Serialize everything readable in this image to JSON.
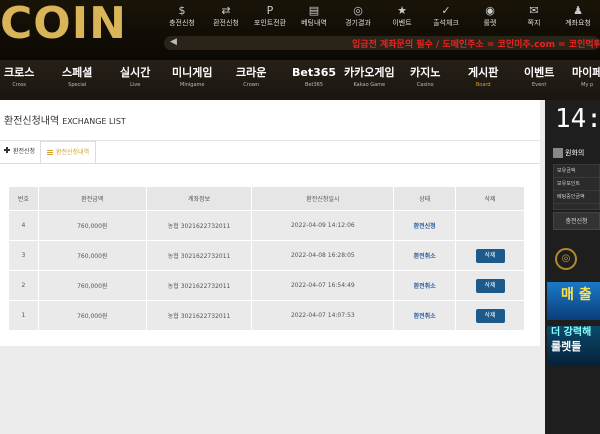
{
  "logo": {
    "text": "COIN"
  },
  "top_menu": [
    {
      "icon": "money-icon",
      "glyph": "$",
      "label": "충전신청"
    },
    {
      "icon": "exchange-icon",
      "glyph": "⇄",
      "label": "환전신청"
    },
    {
      "icon": "points-icon",
      "glyph": "P",
      "label": "포인트전환"
    },
    {
      "icon": "bet-icon",
      "glyph": "▤",
      "label": "베팅내역"
    },
    {
      "icon": "result-icon",
      "glyph": "◎",
      "label": "경기결과"
    },
    {
      "icon": "event-icon",
      "glyph": "★",
      "label": "이벤트"
    },
    {
      "icon": "attendance-icon",
      "glyph": "✓",
      "label": "출석체크"
    },
    {
      "icon": "roulette-icon",
      "glyph": "◉",
      "label": "룰렛"
    },
    {
      "icon": "message-icon",
      "glyph": "✉",
      "label": "쪽지"
    },
    {
      "icon": "account-icon",
      "glyph": "♟",
      "label": "계좌요청"
    }
  ],
  "ticker": {
    "speaker_glyph": "◀",
    "message": "입금전 계좌문의 필수 / 도메인주소 = 코인미추.com = 코인먹튀"
  },
  "nav": [
    {
      "ko": "크로스",
      "en": "Cross"
    },
    {
      "ko": "스페셜",
      "en": "Special"
    },
    {
      "ko": "실시간",
      "en": "Live"
    },
    {
      "ko": "미니게임",
      "en": "Minigame"
    },
    {
      "ko": "크라운",
      "en": "Crown"
    },
    {
      "ko": "Bet365",
      "en": "Bet365"
    },
    {
      "ko": "카카오게임",
      "en": "Kakao Game"
    },
    {
      "ko": "카지노",
      "en": "Casino"
    },
    {
      "ko": "게시판",
      "en": "Board"
    },
    {
      "ko": "이벤트",
      "en": "Event"
    },
    {
      "ko": "마이페",
      "en": "My p"
    }
  ],
  "page": {
    "title": "환전신청내역",
    "title_en": "EXCHANGE LIST"
  },
  "tabs": [
    {
      "label": "환전신청"
    },
    {
      "label": "환전신청내역"
    }
  ],
  "table": {
    "headers": [
      "번호",
      "환전금액",
      "계좌정보",
      "환전신청일시",
      "상태",
      "삭제"
    ],
    "rows": [
      {
        "no": "4",
        "amount": "760,000원",
        "account": "농협 3021622732011",
        "date": "2022-04-09 14:12:06",
        "status": "환전신청",
        "delete": ""
      },
      {
        "no": "3",
        "amount": "760,000원",
        "account": "농협 3021622732011",
        "date": "2022-04-08 16:28:05",
        "status": "환전취소",
        "delete": "삭제"
      },
      {
        "no": "2",
        "amount": "760,000원",
        "account": "농협 3021622732011",
        "date": "2022-04-07 16:54:49",
        "status": "환전취소",
        "delete": "삭제"
      },
      {
        "no": "1",
        "amount": "760,000원",
        "account": "농협 3021622732011",
        "date": "2022-04-07 14:07:53",
        "status": "환전취소",
        "delete": "삭제"
      }
    ]
  },
  "right_sidebar": {
    "clock": "14:",
    "section_title": "원화의",
    "items": [
      "보유금액",
      "보유포인트",
      "베팅중인금액"
    ],
    "button": "충전신청",
    "banner1": "매 출",
    "banner2_line1": "더 강력해",
    "banner2_line2": "룰렛들"
  },
  "colors": {
    "accent_gold": "#d0a030",
    "button_blue": "#1d5a8a",
    "status_blue": "#2a5a9a"
  }
}
